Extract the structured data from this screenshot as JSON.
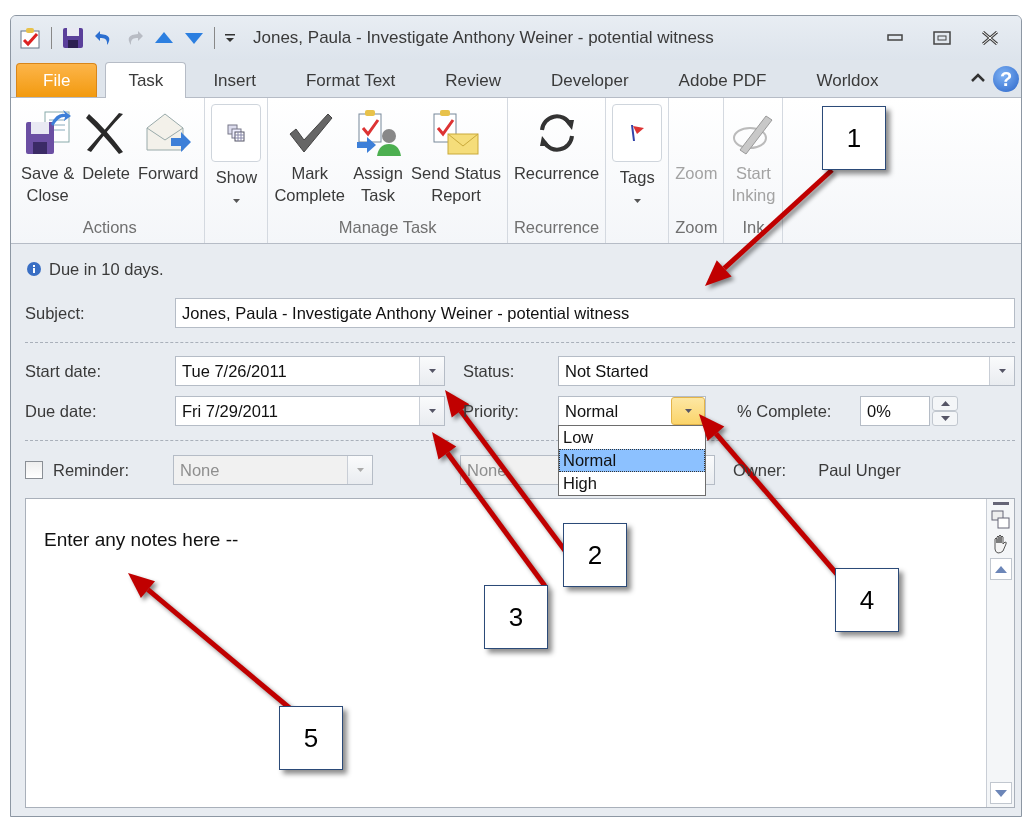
{
  "window": {
    "title": "Jones, Paula - Investigate Anthony Weiner - potential witness"
  },
  "tabs": [
    {
      "label": "File",
      "kind": "backstage",
      "selected": false
    },
    {
      "label": "Task",
      "kind": "tab",
      "selected": true
    },
    {
      "label": "Insert",
      "kind": "tab",
      "selected": false
    },
    {
      "label": "Format Text",
      "kind": "tab",
      "selected": false
    },
    {
      "label": "Review",
      "kind": "tab",
      "selected": false
    },
    {
      "label": "Developer",
      "kind": "tab",
      "selected": false
    },
    {
      "label": "Adobe PDF",
      "kind": "tab",
      "selected": false
    },
    {
      "label": "Worldox",
      "kind": "tab",
      "selected": false
    }
  ],
  "help": "?",
  "ribbon": [
    {
      "label": "Actions",
      "buttons": [
        {
          "label": "Save &\nClose",
          "kind": "save",
          "disabled": false,
          "menu": false
        },
        {
          "label": "Delete",
          "kind": "delete",
          "disabled": false,
          "menu": false
        },
        {
          "label": "Forward",
          "kind": "forward",
          "disabled": false,
          "menu": false
        }
      ]
    },
    {
      "buttons": [
        {
          "label": "Show",
          "kind": "show",
          "disabled": false,
          "menu": true
        }
      ]
    },
    {
      "label": "Manage Task",
      "buttons": [
        {
          "label": "Mark\nComplete",
          "kind": "check",
          "disabled": false,
          "menu": false
        },
        {
          "label": "Assign\nTask",
          "kind": "assign",
          "disabled": false,
          "menu": false
        },
        {
          "label": "Send Status\nReport",
          "kind": "status",
          "disabled": false,
          "menu": false
        }
      ]
    },
    {
      "label": "Recurrence",
      "buttons": [
        {
          "label": "Recurrence",
          "kind": "recurrence",
          "disabled": false,
          "menu": false
        }
      ]
    },
    {
      "buttons": [
        {
          "label": "Tags",
          "kind": "tags",
          "disabled": false,
          "menu": true
        }
      ]
    },
    {
      "label": "Zoom",
      "buttons": [
        {
          "label": "Zoom",
          "kind": "zoom",
          "disabled": true,
          "menu": false
        }
      ]
    },
    {
      "label": "Ink",
      "buttons": [
        {
          "label": "Start\nInking",
          "kind": "ink",
          "disabled": true,
          "menu": false
        }
      ]
    }
  ],
  "info": "Due in 10 days.",
  "subject": {
    "label": "Subject:",
    "value": "Jones, Paula - Investigate Anthony Weiner - potential witness"
  },
  "start_date": {
    "label": "Start date:",
    "value": "Tue 7/26/2011"
  },
  "due_date": {
    "label": "Due date:",
    "value": "Fri 7/29/2011"
  },
  "status": {
    "label": "Status:",
    "value": "Not Started"
  },
  "priority": {
    "label": "Priority:",
    "value": "Normal",
    "expanded": true,
    "options": [
      {
        "label": "Low",
        "selected": false
      },
      {
        "label": "Normal",
        "selected": true
      },
      {
        "label": "High",
        "selected": false
      }
    ]
  },
  "percent_complete": {
    "label": "% Complete:",
    "value": "0%"
  },
  "reminder": {
    "label": "Reminder:",
    "checked": false,
    "disabled": true,
    "date": "None",
    "time": "None"
  },
  "owner": {
    "label": "Owner:",
    "value": "Paul Unger"
  },
  "notes": "Enter any notes here --",
  "callouts": [
    "1",
    "2",
    "3",
    "4",
    "5"
  ]
}
